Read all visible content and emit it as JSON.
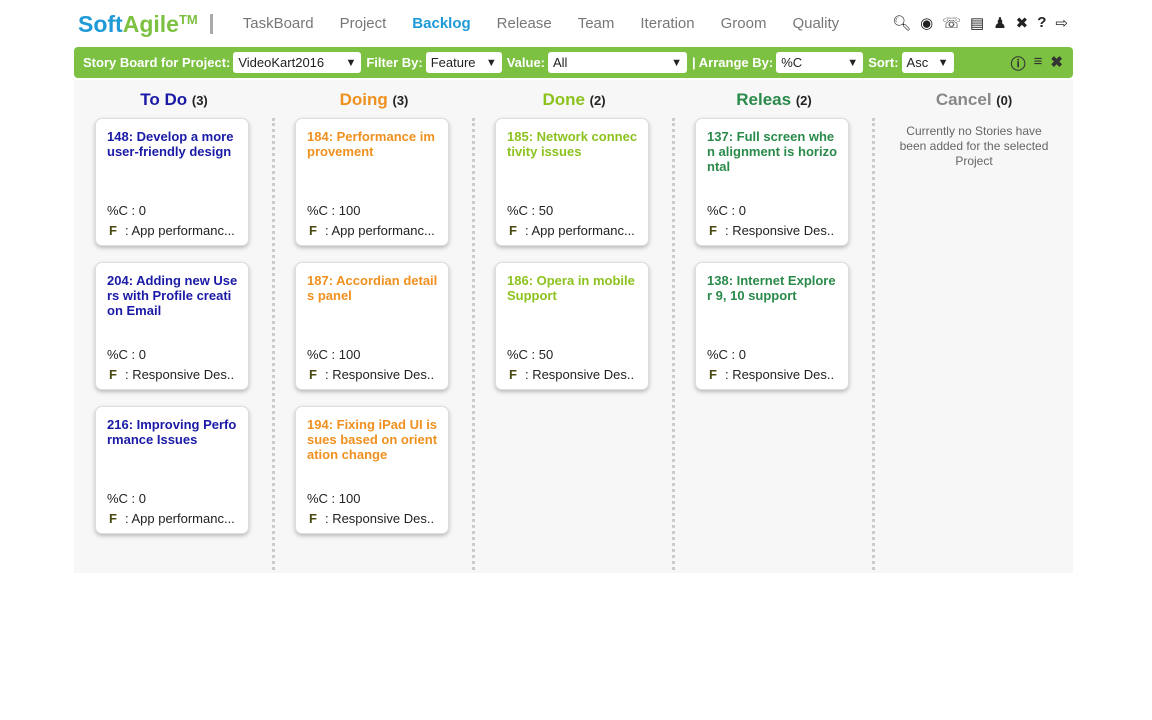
{
  "logo": {
    "a": "Soft",
    "b": "Agile",
    "tm": "TM"
  },
  "nav": [
    "TaskBoard",
    "Project",
    "Backlog",
    "Release",
    "Team",
    "Iteration",
    "Groom",
    "Quality"
  ],
  "active_nav": "Backlog",
  "toolbar": {
    "project_label": "Story Board for Project:",
    "project": "VideoKart2016",
    "filter_label": "Filter By:",
    "filter": "Feature",
    "value_label": "Value:",
    "value": "All",
    "arrange_label": "| Arrange By:",
    "arrange": "%C",
    "sort_label": "Sort:",
    "sort": "Asc"
  },
  "columns": [
    {
      "title": "To Do",
      "count": "(3)",
      "color": "#1a1aa6",
      "cards": [
        {
          "title": "148: Develop a more user-friendly design",
          "pc": "%C : 0",
          "feature": "App performanc..."
        },
        {
          "title": "204: Adding new Users with Profile creation Email",
          "pc": "%C : 0",
          "feature": "Responsive Des.."
        },
        {
          "title": "216: Improving Performance Issues",
          "pc": "%C : 0",
          "feature": "App performanc..."
        }
      ]
    },
    {
      "title": "Doing",
      "count": "(3)",
      "color": "#f0901e",
      "cards": [
        {
          "title": "184: Performance improvement",
          "pc": "%C : 100",
          "feature": "App performanc..."
        },
        {
          "title": "187: Accordian details panel",
          "pc": "%C : 100",
          "feature": "Responsive Des.."
        },
        {
          "title": "194: Fixing iPad UI issues based on orientation change",
          "pc": "%C : 100",
          "feature": "Responsive Des.."
        }
      ]
    },
    {
      "title": "Done",
      "count": "(2)",
      "color": "#8cc21e",
      "cards": [
        {
          "title": "185: Network connectivity issues",
          "pc": "%C : 50",
          "feature": "App performanc..."
        },
        {
          "title": "186: Opera in mobile Support",
          "pc": "%C : 50",
          "feature": "Responsive Des.."
        }
      ]
    },
    {
      "title": "Releas",
      "count": "(2)",
      "color": "#2a8a4a",
      "cards": [
        {
          "title": "137: Full screen when alignment is horizontal",
          "pc": "%C : 0",
          "feature": "Responsive Des.."
        },
        {
          "title": "138: Internet Explorer 9, 10 support",
          "pc": "%C : 0",
          "feature": "Responsive Des.."
        }
      ]
    },
    {
      "title": "Cancel",
      "count": "(0)",
      "color": "#888888",
      "cards": [],
      "empty": "Currently no Stories have been added for the selected Project"
    }
  ],
  "feature_letter": "F"
}
